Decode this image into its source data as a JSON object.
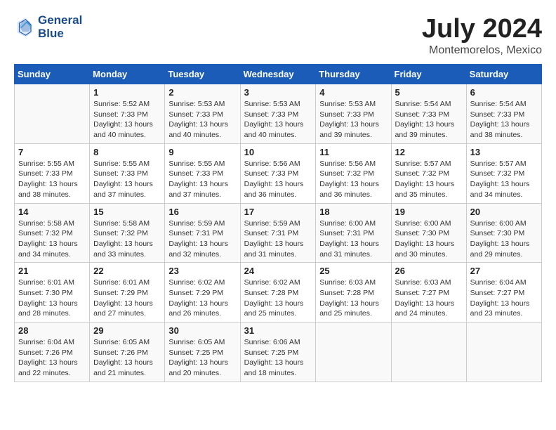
{
  "header": {
    "logo_line1": "General",
    "logo_line2": "Blue",
    "title": "July 2024",
    "subtitle": "Montemorelos, Mexico"
  },
  "days_of_week": [
    "Sunday",
    "Monday",
    "Tuesday",
    "Wednesday",
    "Thursday",
    "Friday",
    "Saturday"
  ],
  "weeks": [
    [
      {
        "day": "",
        "info": ""
      },
      {
        "day": "1",
        "info": "Sunrise: 5:52 AM\nSunset: 7:33 PM\nDaylight: 13 hours\nand 40 minutes."
      },
      {
        "day": "2",
        "info": "Sunrise: 5:53 AM\nSunset: 7:33 PM\nDaylight: 13 hours\nand 40 minutes."
      },
      {
        "day": "3",
        "info": "Sunrise: 5:53 AM\nSunset: 7:33 PM\nDaylight: 13 hours\nand 40 minutes."
      },
      {
        "day": "4",
        "info": "Sunrise: 5:53 AM\nSunset: 7:33 PM\nDaylight: 13 hours\nand 39 minutes."
      },
      {
        "day": "5",
        "info": "Sunrise: 5:54 AM\nSunset: 7:33 PM\nDaylight: 13 hours\nand 39 minutes."
      },
      {
        "day": "6",
        "info": "Sunrise: 5:54 AM\nSunset: 7:33 PM\nDaylight: 13 hours\nand 38 minutes."
      }
    ],
    [
      {
        "day": "7",
        "info": "Sunrise: 5:55 AM\nSunset: 7:33 PM\nDaylight: 13 hours\nand 38 minutes."
      },
      {
        "day": "8",
        "info": "Sunrise: 5:55 AM\nSunset: 7:33 PM\nDaylight: 13 hours\nand 37 minutes."
      },
      {
        "day": "9",
        "info": "Sunrise: 5:55 AM\nSunset: 7:33 PM\nDaylight: 13 hours\nand 37 minutes."
      },
      {
        "day": "10",
        "info": "Sunrise: 5:56 AM\nSunset: 7:33 PM\nDaylight: 13 hours\nand 36 minutes."
      },
      {
        "day": "11",
        "info": "Sunrise: 5:56 AM\nSunset: 7:32 PM\nDaylight: 13 hours\nand 36 minutes."
      },
      {
        "day": "12",
        "info": "Sunrise: 5:57 AM\nSunset: 7:32 PM\nDaylight: 13 hours\nand 35 minutes."
      },
      {
        "day": "13",
        "info": "Sunrise: 5:57 AM\nSunset: 7:32 PM\nDaylight: 13 hours\nand 34 minutes."
      }
    ],
    [
      {
        "day": "14",
        "info": "Sunrise: 5:58 AM\nSunset: 7:32 PM\nDaylight: 13 hours\nand 34 minutes."
      },
      {
        "day": "15",
        "info": "Sunrise: 5:58 AM\nSunset: 7:32 PM\nDaylight: 13 hours\nand 33 minutes."
      },
      {
        "day": "16",
        "info": "Sunrise: 5:59 AM\nSunset: 7:31 PM\nDaylight: 13 hours\nand 32 minutes."
      },
      {
        "day": "17",
        "info": "Sunrise: 5:59 AM\nSunset: 7:31 PM\nDaylight: 13 hours\nand 31 minutes."
      },
      {
        "day": "18",
        "info": "Sunrise: 6:00 AM\nSunset: 7:31 PM\nDaylight: 13 hours\nand 31 minutes."
      },
      {
        "day": "19",
        "info": "Sunrise: 6:00 AM\nSunset: 7:30 PM\nDaylight: 13 hours\nand 30 minutes."
      },
      {
        "day": "20",
        "info": "Sunrise: 6:00 AM\nSunset: 7:30 PM\nDaylight: 13 hours\nand 29 minutes."
      }
    ],
    [
      {
        "day": "21",
        "info": "Sunrise: 6:01 AM\nSunset: 7:30 PM\nDaylight: 13 hours\nand 28 minutes."
      },
      {
        "day": "22",
        "info": "Sunrise: 6:01 AM\nSunset: 7:29 PM\nDaylight: 13 hours\nand 27 minutes."
      },
      {
        "day": "23",
        "info": "Sunrise: 6:02 AM\nSunset: 7:29 PM\nDaylight: 13 hours\nand 26 minutes."
      },
      {
        "day": "24",
        "info": "Sunrise: 6:02 AM\nSunset: 7:28 PM\nDaylight: 13 hours\nand 25 minutes."
      },
      {
        "day": "25",
        "info": "Sunrise: 6:03 AM\nSunset: 7:28 PM\nDaylight: 13 hours\nand 25 minutes."
      },
      {
        "day": "26",
        "info": "Sunrise: 6:03 AM\nSunset: 7:27 PM\nDaylight: 13 hours\nand 24 minutes."
      },
      {
        "day": "27",
        "info": "Sunrise: 6:04 AM\nSunset: 7:27 PM\nDaylight: 13 hours\nand 23 minutes."
      }
    ],
    [
      {
        "day": "28",
        "info": "Sunrise: 6:04 AM\nSunset: 7:26 PM\nDaylight: 13 hours\nand 22 minutes."
      },
      {
        "day": "29",
        "info": "Sunrise: 6:05 AM\nSunset: 7:26 PM\nDaylight: 13 hours\nand 21 minutes."
      },
      {
        "day": "30",
        "info": "Sunrise: 6:05 AM\nSunset: 7:25 PM\nDaylight: 13 hours\nand 20 minutes."
      },
      {
        "day": "31",
        "info": "Sunrise: 6:06 AM\nSunset: 7:25 PM\nDaylight: 13 hours\nand 18 minutes."
      },
      {
        "day": "",
        "info": ""
      },
      {
        "day": "",
        "info": ""
      },
      {
        "day": "",
        "info": ""
      }
    ]
  ]
}
